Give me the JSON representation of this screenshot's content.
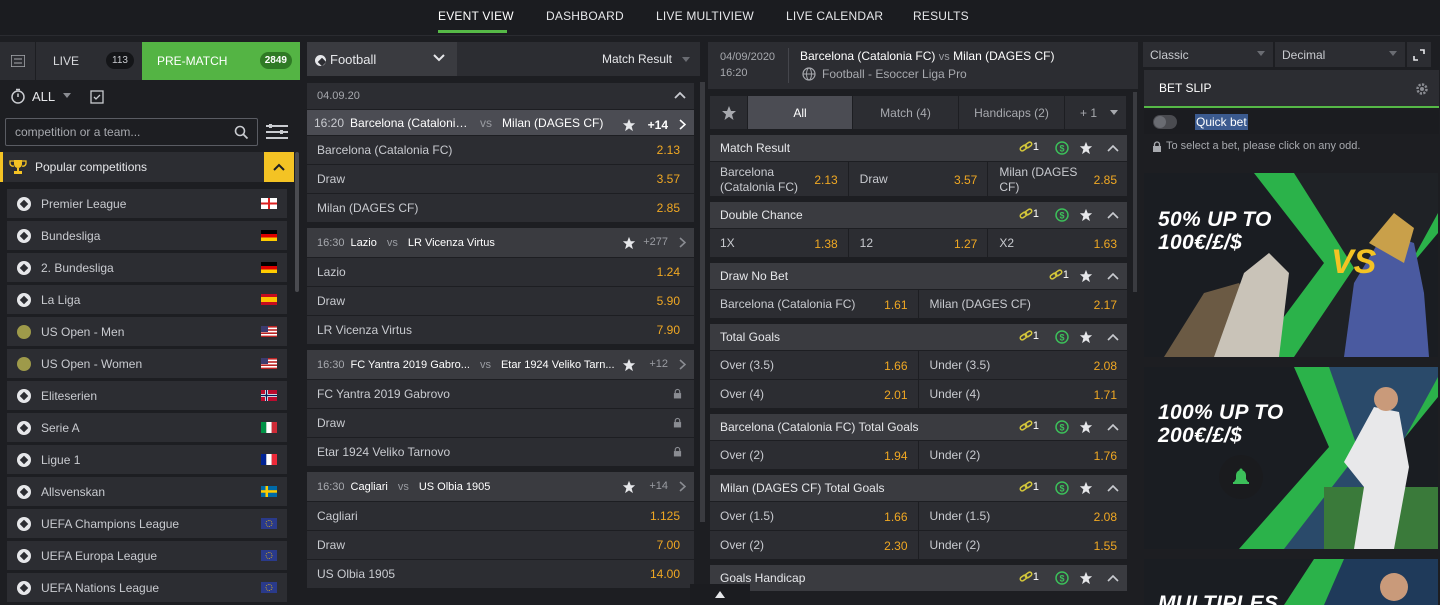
{
  "topnav": {
    "tabs": [
      "EVENT VIEW",
      "DASHBOARD",
      "LIVE MULTIVIEW",
      "LIVE CALENDAR",
      "RESULTS"
    ],
    "active_tab": "EVENT VIEW",
    "accent": "#56b947"
  },
  "left": {
    "live_label": "LIVE",
    "live_count": "113",
    "prematch_label": "PRE-MATCH",
    "prematch_count": "2849",
    "filter_label": "ALL",
    "search_placeholder": "competition or a team...",
    "popular_label": "Popular competitions",
    "competitions": [
      {
        "name": "Premier League",
        "icon": "football-icon",
        "flag": "england"
      },
      {
        "name": "Bundesliga",
        "icon": "football-icon",
        "flag": "germany"
      },
      {
        "name": "2. Bundesliga",
        "icon": "football-icon",
        "flag": "germany"
      },
      {
        "name": "La Liga",
        "icon": "football-icon",
        "flag": "spain"
      },
      {
        "name": "US Open - Men",
        "icon": "tennis-ball-icon",
        "flag": "usa"
      },
      {
        "name": "US Open - Women",
        "icon": "tennis-ball-icon",
        "flag": "usa"
      },
      {
        "name": "Eliteserien",
        "icon": "football-icon",
        "flag": "norway"
      },
      {
        "name": "Serie A",
        "icon": "football-icon",
        "flag": "italy"
      },
      {
        "name": "Ligue 1",
        "icon": "football-icon",
        "flag": "france"
      },
      {
        "name": "Allsvenskan",
        "icon": "football-icon",
        "flag": "sweden"
      },
      {
        "name": "UEFA Champions League",
        "icon": "football-icon",
        "flag": "europe"
      },
      {
        "name": "UEFA Europa League",
        "icon": "football-icon",
        "flag": "europe"
      },
      {
        "name": "UEFA Nations League",
        "icon": "football-icon",
        "flag": "europe"
      }
    ]
  },
  "middle": {
    "sport": "Football",
    "market": "Match Result",
    "date": "04.09.20",
    "events": [
      {
        "time": "16:20",
        "home": "Barcelona (Catalonia FC)",
        "home_short": "Barcelona (Catalonia ...",
        "vs": "vs",
        "away": "Milan (DAGES CF)",
        "away_short": "Milan (DAGES CF)",
        "more": "+14",
        "selected": true,
        "rows": [
          {
            "label": "Barcelona (Catalonia FC)",
            "odd": "2.13"
          },
          {
            "label": "Draw",
            "odd": "3.57"
          },
          {
            "label": "Milan (DAGES CF)",
            "odd": "2.85"
          }
        ]
      },
      {
        "time": "16:30",
        "home": "Lazio",
        "home_short": "Lazio",
        "vs": "vs",
        "away": "LR Vicenza Virtus",
        "away_short": "LR Vicenza Virtus",
        "more": "+277",
        "selected": false,
        "rows": [
          {
            "label": "Lazio",
            "odd": "1.24"
          },
          {
            "label": "Draw",
            "odd": "5.90"
          },
          {
            "label": "LR Vicenza Virtus",
            "odd": "7.90"
          }
        ]
      },
      {
        "time": "16:30",
        "home": "FC Yantra 2019 Gabrovo",
        "home_short": "FC Yantra 2019 Gabro...",
        "vs": "vs",
        "away": "Etar 1924 Veliko Tarnovo",
        "away_short": "Etar 1924 Veliko Tarn...",
        "more": "+12",
        "selected": false,
        "rows": [
          {
            "label": "FC Yantra 2019 Gabrovo",
            "odd": "",
            "locked": true
          },
          {
            "label": "Draw",
            "odd": "",
            "locked": true
          },
          {
            "label": "Etar 1924 Veliko Tarnovo",
            "odd": "",
            "locked": true
          }
        ]
      },
      {
        "time": "16:30",
        "home": "Cagliari",
        "home_short": "Cagliari",
        "vs": "vs",
        "away": "US Olbia 1905",
        "away_short": "US Olbia 1905",
        "more": "+14",
        "selected": false,
        "rows": [
          {
            "label": "Cagliari",
            "odd": "1.125"
          },
          {
            "label": "Draw",
            "odd": "7.00"
          },
          {
            "label": "US Olbia 1905",
            "odd": "14.00"
          }
        ]
      }
    ]
  },
  "detail": {
    "date": "04/09/2020",
    "time": "16:20",
    "home": "Barcelona (Catalonia FC)",
    "vs": "vs",
    "away": "Milan (DAGES CF)",
    "league": "Football - Esoccer Liga Pro",
    "tabs": [
      {
        "label": "All",
        "active": true
      },
      {
        "label": "Match (4)",
        "active": false
      },
      {
        "label": "Handicaps (2)",
        "active": false
      },
      {
        "label": "+ 1",
        "active": false
      }
    ],
    "markets": [
      {
        "title": "Match Result",
        "link_count": "1",
        "cash": true,
        "rows": [
          [
            {
              "l": "Barcelona (Catalonia FC)",
              "v": "2.13"
            },
            {
              "l": "Draw",
              "v": "3.57"
            },
            {
              "l": "Milan (DAGES CF)",
              "v": "2.85"
            }
          ]
        ]
      },
      {
        "title": "Double Chance",
        "link_count": "1",
        "cash": true,
        "rows": [
          [
            {
              "l": "1X",
              "v": "1.38"
            },
            {
              "l": "12",
              "v": "1.27"
            },
            {
              "l": "X2",
              "v": "1.63"
            }
          ]
        ]
      },
      {
        "title": "Draw No Bet",
        "link_count": "1",
        "cash": false,
        "rows": [
          [
            {
              "l": "Barcelona (Catalonia FC)",
              "v": "1.61"
            },
            {
              "l": "Milan (DAGES CF)",
              "v": "2.17"
            }
          ]
        ]
      },
      {
        "title": "Total Goals",
        "link_count": "1",
        "cash": true,
        "rows": [
          [
            {
              "l": "Over (3.5)",
              "v": "1.66"
            },
            {
              "l": "Under (3.5)",
              "v": "2.08"
            }
          ],
          [
            {
              "l": "Over (4)",
              "v": "2.01"
            },
            {
              "l": "Under (4)",
              "v": "1.71"
            }
          ]
        ]
      },
      {
        "title": "Barcelona (Catalonia FC) Total Goals",
        "link_count": "1",
        "cash": true,
        "rows": [
          [
            {
              "l": "Over (2)",
              "v": "1.94"
            },
            {
              "l": "Under (2)",
              "v": "1.76"
            }
          ]
        ]
      },
      {
        "title": "Milan (DAGES CF) Total Goals",
        "link_count": "1",
        "cash": true,
        "rows": [
          [
            {
              "l": "Over (1.5)",
              "v": "1.66"
            },
            {
              "l": "Under (1.5)",
              "v": "2.08"
            }
          ],
          [
            {
              "l": "Over (2)",
              "v": "2.30"
            },
            {
              "l": "Under (2)",
              "v": "1.55"
            }
          ]
        ]
      },
      {
        "title": "Goals Handicap",
        "link_count": "1",
        "cash": true,
        "rows": []
      }
    ]
  },
  "right": {
    "view_select": "Classic",
    "odds_select": "Decimal",
    "betslip_title": "BET SLIP",
    "quick_bet": "Quick bet",
    "hint": "To select a bet, please click on any odd.",
    "banners": [
      {
        "text_line1": "50% UP TO",
        "text_line2": "100€/£/$",
        "badge": "VS"
      },
      {
        "text_line1": "100% UP TO",
        "text_line2": "200€/£/$"
      },
      {
        "text_line1": "MULTIPLES",
        "text_line2": ""
      }
    ]
  }
}
